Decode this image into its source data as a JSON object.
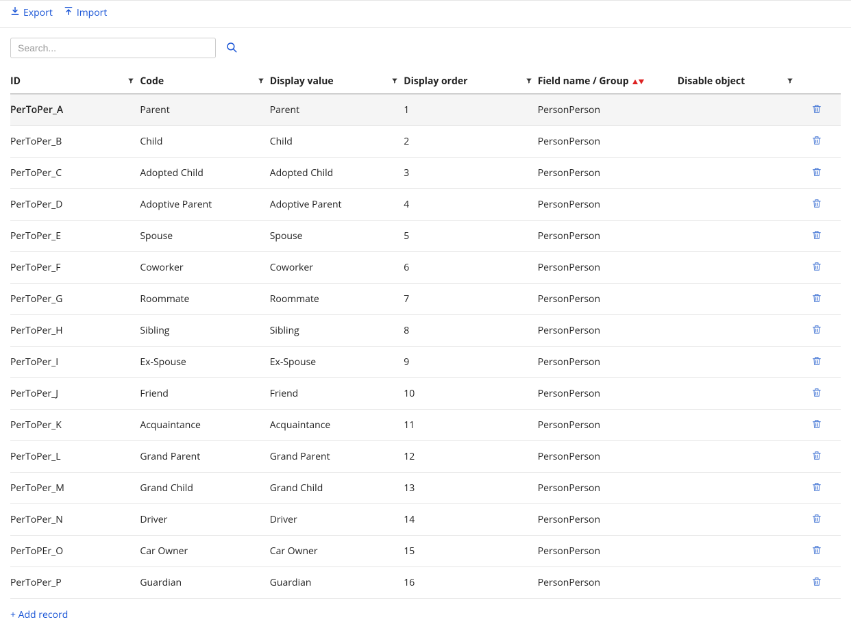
{
  "toolbar": {
    "export_label": "Export",
    "import_label": "Import"
  },
  "search": {
    "placeholder": "Search..."
  },
  "columns": [
    {
      "key": "id",
      "label": "ID",
      "filter": true,
      "sort": null
    },
    {
      "key": "code",
      "label": "Code",
      "filter": true,
      "sort": null
    },
    {
      "key": "display_value",
      "label": "Display value",
      "filter": true,
      "sort": null
    },
    {
      "key": "display_order",
      "label": "Display order",
      "filter": true,
      "sort": null
    },
    {
      "key": "field_group",
      "label": "Field name / Group",
      "filter": false,
      "sort": "both"
    },
    {
      "key": "disable_object",
      "label": "Disable object",
      "filter": true,
      "sort": null
    }
  ],
  "rows": [
    {
      "id": "PerToPer_A",
      "code": "Parent",
      "display_value": "Parent",
      "display_order": "1",
      "field_group": "PersonPerson",
      "disable_object": "",
      "selected": true
    },
    {
      "id": "PerToPer_B",
      "code": "Child",
      "display_value": "Child",
      "display_order": "2",
      "field_group": "PersonPerson",
      "disable_object": "",
      "selected": false
    },
    {
      "id": "PerToPer_C",
      "code": "Adopted Child",
      "display_value": "Adopted Child",
      "display_order": "3",
      "field_group": "PersonPerson",
      "disable_object": "",
      "selected": false
    },
    {
      "id": "PerToPer_D",
      "code": "Adoptive Parent",
      "display_value": "Adoptive Parent",
      "display_order": "4",
      "field_group": "PersonPerson",
      "disable_object": "",
      "selected": false
    },
    {
      "id": "PerToPer_E",
      "code": "Spouse",
      "display_value": "Spouse",
      "display_order": "5",
      "field_group": "PersonPerson",
      "disable_object": "",
      "selected": false
    },
    {
      "id": "PerToPer_F",
      "code": "Coworker",
      "display_value": "Coworker",
      "display_order": "6",
      "field_group": "PersonPerson",
      "disable_object": "",
      "selected": false
    },
    {
      "id": "PerToPer_G",
      "code": "Roommate",
      "display_value": "Roommate",
      "display_order": "7",
      "field_group": "PersonPerson",
      "disable_object": "",
      "selected": false
    },
    {
      "id": "PerToPer_H",
      "code": "Sibling",
      "display_value": "Sibling",
      "display_order": "8",
      "field_group": "PersonPerson",
      "disable_object": "",
      "selected": false
    },
    {
      "id": "PerToPer_I",
      "code": "Ex-Spouse",
      "display_value": "Ex-Spouse",
      "display_order": "9",
      "field_group": "PersonPerson",
      "disable_object": "",
      "selected": false
    },
    {
      "id": "PerToPer_J",
      "code": "Friend",
      "display_value": "Friend",
      "display_order": "10",
      "field_group": "PersonPerson",
      "disable_object": "",
      "selected": false
    },
    {
      "id": "PerToPer_K",
      "code": "Acquaintance",
      "display_value": "Acquaintance",
      "display_order": "11",
      "field_group": "PersonPerson",
      "disable_object": "",
      "selected": false
    },
    {
      "id": "PerToPer_L",
      "code": "Grand Parent",
      "display_value": "Grand Parent",
      "display_order": "12",
      "field_group": "PersonPerson",
      "disable_object": "",
      "selected": false
    },
    {
      "id": "PerToPer_M",
      "code": "Grand Child",
      "display_value": "Grand Child",
      "display_order": "13",
      "field_group": "PersonPerson",
      "disable_object": "",
      "selected": false
    },
    {
      "id": "PerToPer_N",
      "code": "Driver",
      "display_value": "Driver",
      "display_order": "14",
      "field_group": "PersonPerson",
      "disable_object": "",
      "selected": false
    },
    {
      "id": "PerToPEr_O",
      "code": "Car Owner",
      "display_value": "Car Owner",
      "display_order": "15",
      "field_group": "PersonPerson",
      "disable_object": "",
      "selected": false
    },
    {
      "id": "PerToPer_P",
      "code": "Guardian",
      "display_value": "Guardian",
      "display_order": "16",
      "field_group": "PersonPerson",
      "disable_object": "",
      "selected": false
    }
  ],
  "footer": {
    "add_record_label": "+ Add record"
  }
}
